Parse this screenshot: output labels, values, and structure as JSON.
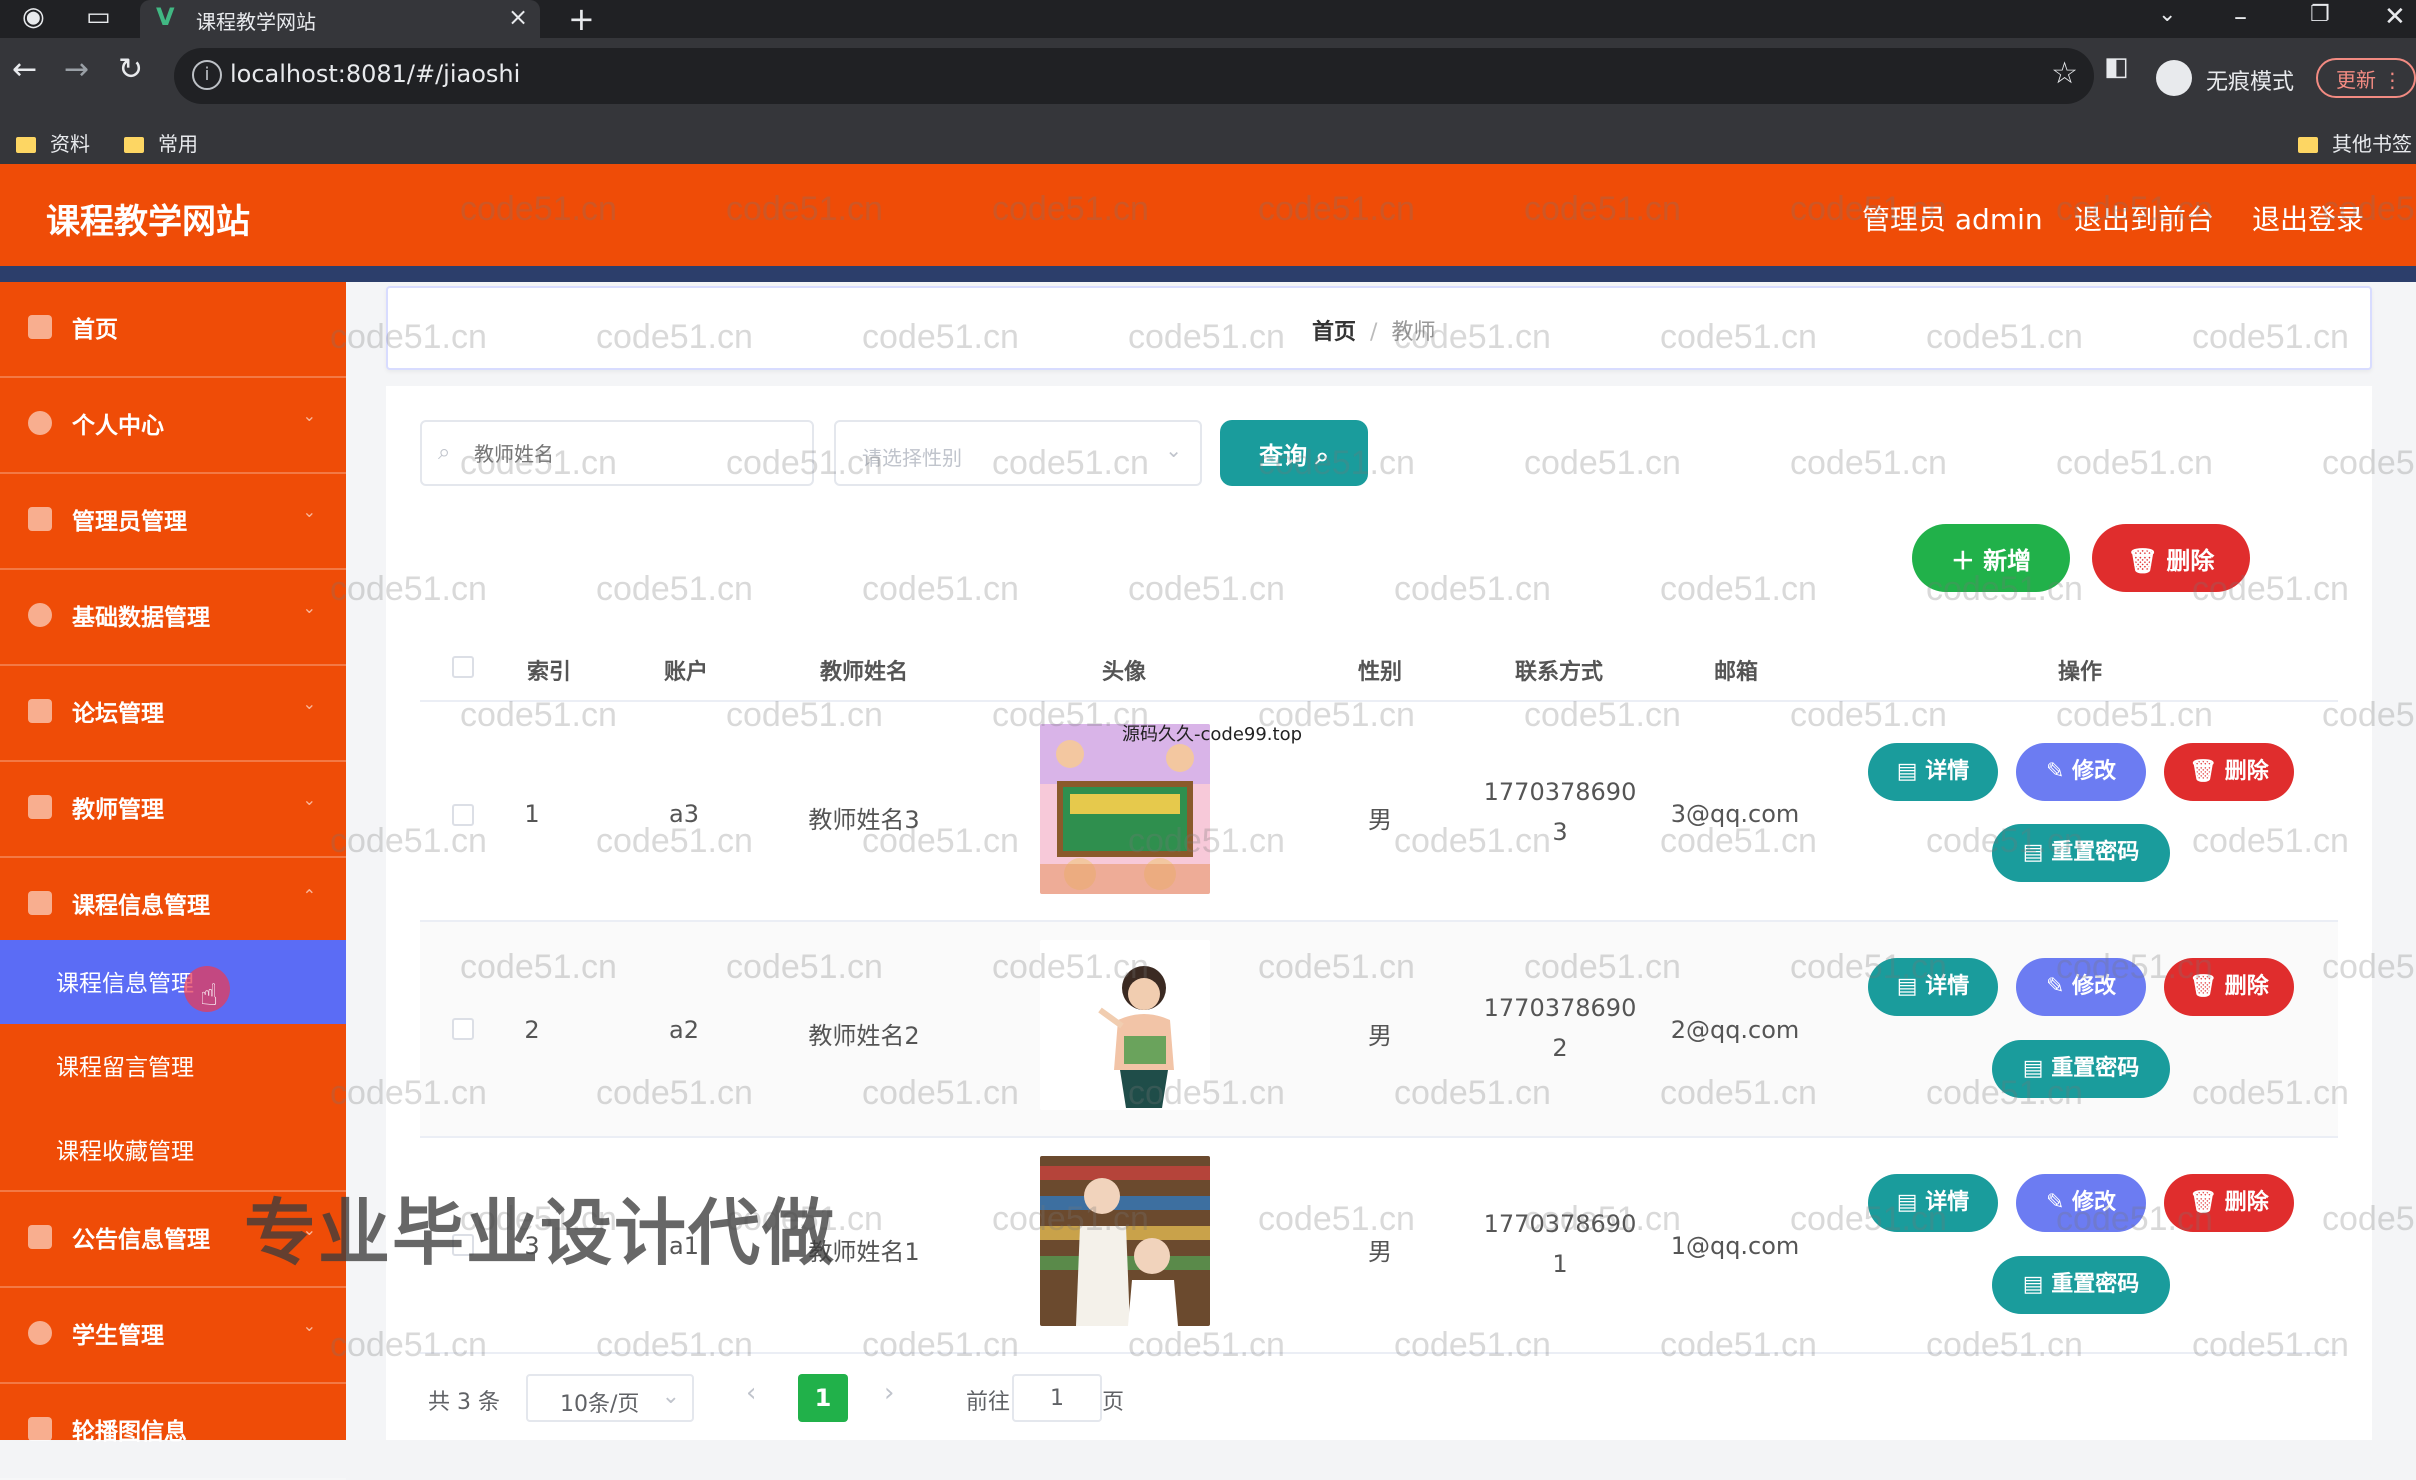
{
  "browser": {
    "tab_title": "课程教学网站",
    "url": "localhost:8081/#/jiaoshi",
    "incognito_label": "无痕模式",
    "update_label": "更新",
    "bookmarks": [
      "资料",
      "常用"
    ],
    "other_bookmarks": "其他书签"
  },
  "header": {
    "title": "课程教学网站",
    "user_label": "管理员 admin",
    "back_to_front": "退出到前台",
    "logout": "退出登录"
  },
  "sidebar": {
    "items": [
      {
        "label": "首页"
      },
      {
        "label": "个人中心"
      },
      {
        "label": "管理员管理"
      },
      {
        "label": "基础数据管理"
      },
      {
        "label": "论坛管理"
      },
      {
        "label": "教师管理"
      },
      {
        "label": "课程信息管理"
      }
    ],
    "sub_items": [
      {
        "label": "课程信息管理"
      },
      {
        "label": "课程留言管理"
      },
      {
        "label": "课程收藏管理"
      }
    ],
    "items_after": [
      {
        "label": "公告信息管理"
      },
      {
        "label": "学生管理"
      },
      {
        "label": "轮播图信息"
      }
    ]
  },
  "breadcrumb": {
    "home": "首页",
    "separator": "/",
    "current": "教师"
  },
  "search": {
    "name_placeholder": "教师姓名",
    "gender_placeholder": "请选择性别",
    "query_label": "查询"
  },
  "actions": {
    "add_label": "新增",
    "delete_label": "删除"
  },
  "table": {
    "columns": [
      "索引",
      "账户",
      "教师姓名",
      "头像",
      "性别",
      "联系方式",
      "邮箱",
      "操作"
    ],
    "rows": [
      {
        "index": "1",
        "account": "a3",
        "name": "教师姓名3",
        "gender": "男",
        "phone_line1": "1770378690",
        "phone_line2": "3",
        "email": "3@qq.com"
      },
      {
        "index": "2",
        "account": "a2",
        "name": "教师姓名2",
        "gender": "男",
        "phone_line1": "1770378690",
        "phone_line2": "2",
        "email": "2@qq.com"
      },
      {
        "index": "3",
        "account": "a1",
        "name": "教师姓名1",
        "gender": "男",
        "phone_line1": "1770378690",
        "phone_line2": "1",
        "email": "1@qq.com"
      }
    ],
    "row_actions": {
      "detail": "详情",
      "edit": "修改",
      "delete": "删除",
      "reset": "重置密码"
    }
  },
  "pagination": {
    "total": "共 3 条",
    "page_size": "10条/页",
    "current": "1",
    "goto_label": "前往",
    "goto_value": "1",
    "page_suffix": "页"
  },
  "overlays": {
    "watermark": "code51.cn",
    "banner": "专业毕业设计代做",
    "small_text": "源码久久-code99.top"
  },
  "colors": {
    "header": "#ef4c07",
    "active_menu": "#5b6cf5",
    "teal": "#1a9c9c",
    "green": "#21b14a",
    "red": "#e02d2d",
    "edit": "#6c7cf2"
  }
}
